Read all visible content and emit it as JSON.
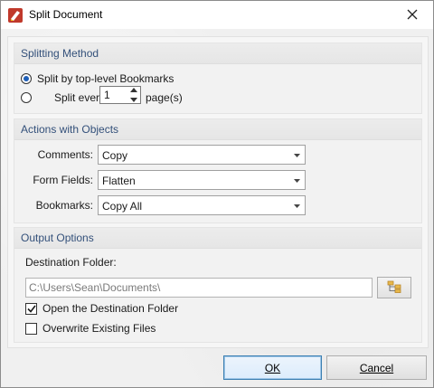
{
  "window": {
    "title": "Split Document",
    "icon": "pdf-xchange-app-icon",
    "close_icon": "close-icon"
  },
  "splitting_method": {
    "header": "Splitting Method",
    "option_bookmarks_label": "Split by top-level Bookmarks",
    "option_bookmarks_selected": true,
    "option_every_label": "Split every",
    "option_every_selected": false,
    "every_value": "1",
    "every_suffix": "page(s)"
  },
  "actions_with_objects": {
    "header": "Actions with Objects",
    "comments_label": "Comments:",
    "comments_value": "Copy",
    "form_fields_label": "Form Fields:",
    "form_fields_value": "Flatten",
    "bookmarks_label": "Bookmarks:",
    "bookmarks_value": "Copy All"
  },
  "output_options": {
    "header": "Output Options",
    "destination_label": "Destination Folder:",
    "destination_value": "C:\\Users\\Sean\\Documents\\",
    "browse_icon": "folder-tree-icon",
    "open_destination_label": "Open the Destination Folder",
    "open_destination_checked": true,
    "overwrite_label": "Overwrite Existing Files",
    "overwrite_checked": false
  },
  "buttons": {
    "ok_label": "OK",
    "cancel_label": "Cancel"
  },
  "colors": {
    "accent": "#1f5fb8",
    "group_header_text": "#33507a",
    "ok_border": "#3c7fb1"
  }
}
